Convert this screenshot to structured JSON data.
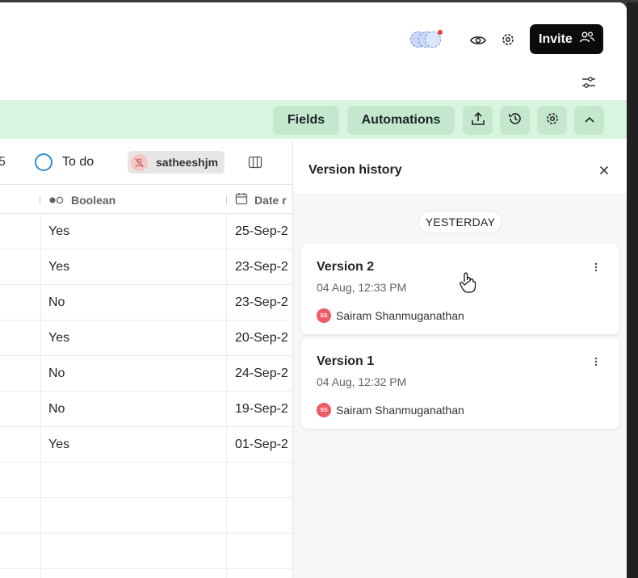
{
  "header": {
    "invite_label": "Invite"
  },
  "toolbar": {
    "fields_label": "Fields",
    "automations_label": "Automations"
  },
  "filters": {
    "truncated_count": "5",
    "status_label": "To do",
    "user_label": "satheeshjm"
  },
  "table": {
    "columns": [
      {
        "label": "Boolean",
        "icon": "boolean-toggle-icon"
      },
      {
        "label": "Date r",
        "icon": "calendar-icon"
      }
    ],
    "rows": [
      {
        "boolean": "Yes",
        "date": "25-Sep-2"
      },
      {
        "boolean": "Yes",
        "date": "23-Sep-2"
      },
      {
        "boolean": "No",
        "date": "23-Sep-2"
      },
      {
        "boolean": "Yes",
        "date": "20-Sep-2"
      },
      {
        "boolean": "No",
        "date": "24-Sep-2"
      },
      {
        "boolean": "No",
        "date": "19-Sep-2"
      },
      {
        "boolean": "Yes",
        "date": "01-Sep-2"
      },
      {
        "boolean": "",
        "date": ""
      },
      {
        "boolean": "",
        "date": ""
      },
      {
        "boolean": "",
        "date": ""
      },
      {
        "boolean": "",
        "date": ""
      }
    ]
  },
  "version_panel": {
    "title": "Version history",
    "day_label": "YESTERDAY",
    "versions": [
      {
        "name": "Version 2",
        "time": "04 Aug, 12:33 PM",
        "author": "Sairam Shanmuganathan",
        "initials": "SS"
      },
      {
        "name": "Version 1",
        "time": "04 Aug, 12:32 PM",
        "author": "Sairam Shanmuganathan",
        "initials": "SS"
      }
    ]
  },
  "colors": {
    "toolbar_bg": "#d9f5e0",
    "toolbar_btn": "#c4e8cd",
    "invite_bg": "#0b0b0b",
    "status_ring": "#2e8dd6",
    "author_avatar": "#ee5b66",
    "notification_dot": "#ee3b3b"
  }
}
